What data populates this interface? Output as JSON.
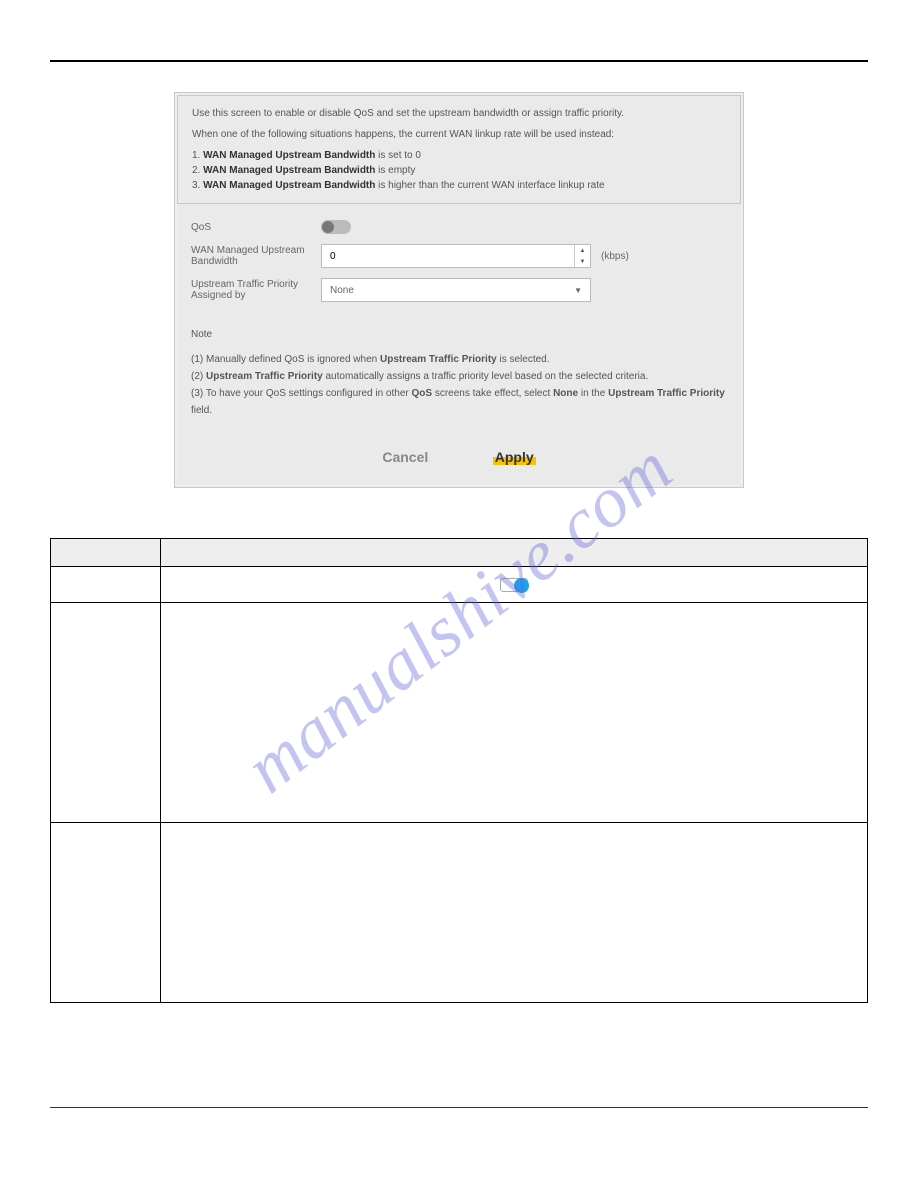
{
  "info": {
    "intro": "Use this screen to enable or disable QoS and set the upstream bandwidth or assign traffic priority.",
    "cond_intro": "When one of the following situations happens, the current WAN linkup rate will be used instead:",
    "cond1_pre": "1. ",
    "cond1_b": "WAN Managed Upstream Bandwidth",
    "cond1_post": " is set to 0",
    "cond2_pre": "2. ",
    "cond2_b": "WAN Managed Upstream Bandwidth",
    "cond2_post": " is empty",
    "cond3_pre": "3. ",
    "cond3_b": "WAN Managed Upstream Bandwidth",
    "cond3_post": " is higher than the current WAN interface linkup rate"
  },
  "form": {
    "qos_label": "QoS",
    "bw_label": "WAN Managed Upstream Bandwidth",
    "bw_value": "0",
    "bw_unit": "(kbps)",
    "priority_label": "Upstream Traffic Priority Assigned by",
    "priority_value": "None"
  },
  "notes": {
    "heading": "Note",
    "n1_pre": "(1) Manually defined QoS is ignored when ",
    "n1_b": "Upstream Traffic Priority",
    "n1_post": " is selected.",
    "n2_pre": "(2) ",
    "n2_b": "Upstream Traffic Priority",
    "n2_post": " automatically assigns a traffic priority level based on the selected criteria.",
    "n3_pre": "(3) To have your QoS settings configured in other ",
    "n3_b1": "QoS",
    "n3_mid1": " screens take effect, select ",
    "n3_b2": "None",
    "n3_mid2": " in the ",
    "n3_b3": "Upstream Traffic Priority",
    "n3_post": " field."
  },
  "buttons": {
    "cancel": "Cancel",
    "apply": "Apply"
  },
  "watermark": "manualshive.com"
}
